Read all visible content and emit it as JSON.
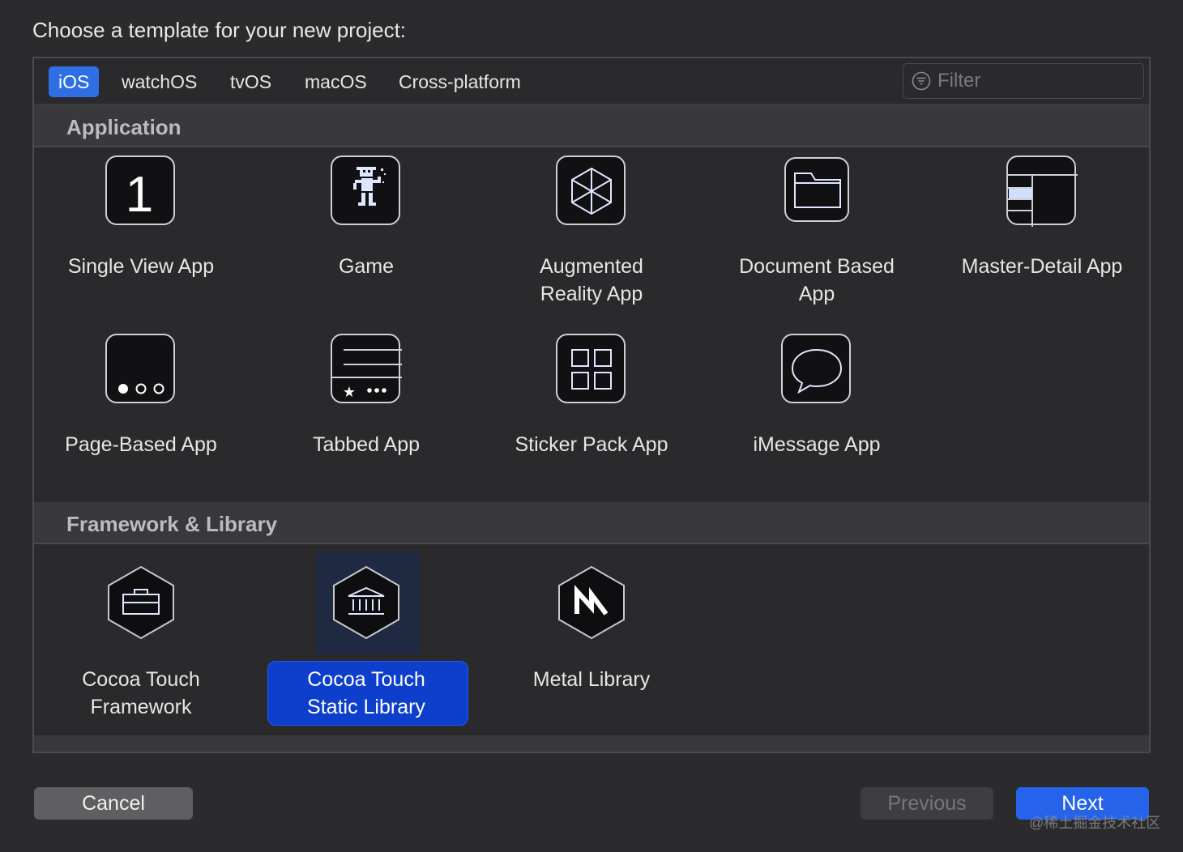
{
  "heading": "Choose a template for your new project:",
  "tabs": [
    "iOS",
    "watchOS",
    "tvOS",
    "macOS",
    "Cross-platform"
  ],
  "active_tab": "iOS",
  "filter": {
    "placeholder": "Filter"
  },
  "sections": {
    "application": {
      "title": "Application",
      "items": [
        {
          "line1": "Single View App",
          "line2": "",
          "icon": "single-view-icon"
        },
        {
          "line1": "Game",
          "line2": "",
          "icon": "game-icon"
        },
        {
          "line1": "Augmented",
          "line2": "Reality App",
          "icon": "ar-cube-icon"
        },
        {
          "line1": "Document Based",
          "line2": "App",
          "icon": "folder-icon"
        },
        {
          "line1": "Master-Detail App",
          "line2": "",
          "icon": "master-detail-icon"
        },
        {
          "line1": "Page-Based App",
          "line2": "",
          "icon": "page-dots-icon"
        },
        {
          "line1": "Tabbed App",
          "line2": "",
          "icon": "tab-bar-icon"
        },
        {
          "line1": "Sticker Pack App",
          "line2": "",
          "icon": "sticker-grid-icon"
        },
        {
          "line1": "iMessage App",
          "line2": "",
          "icon": "speech-bubble-icon"
        }
      ]
    },
    "framework": {
      "title": "Framework & Library",
      "items": [
        {
          "line1": "Cocoa Touch",
          "line2": "Framework",
          "icon": "toolbox-icon"
        },
        {
          "line1": "Cocoa Touch",
          "line2": "Static Library",
          "icon": "library-building-icon",
          "selected": true
        },
        {
          "line1": "Metal Library",
          "line2": "",
          "icon": "metal-icon"
        }
      ]
    }
  },
  "buttons": {
    "cancel": "Cancel",
    "previous": "Previous",
    "next": "Next"
  },
  "watermark": "@稀土掘金技术社区",
  "colors": {
    "accent": "#2e6fe6",
    "selection": "#0e3fcc",
    "background": "#2b2b2d"
  }
}
